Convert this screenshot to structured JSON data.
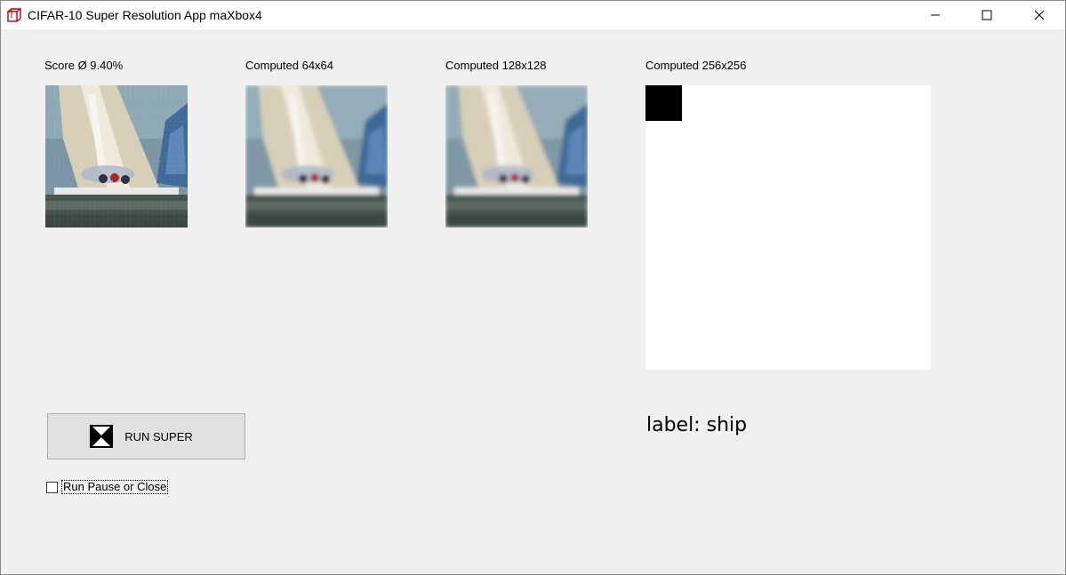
{
  "window": {
    "title": "CIFAR-10 Super Resolution App maXbox4"
  },
  "panels": [
    {
      "label": "Score Ø 9.40%"
    },
    {
      "label": "Computed 64x64"
    },
    {
      "label": "Computed 128x128"
    },
    {
      "label": "Computed 256x256"
    }
  ],
  "result": {
    "label": "label: ship"
  },
  "controls": {
    "run_button_label": "RUN SUPER",
    "run_button_icon": "x-hourglass-icon",
    "checkbox_label": "Run Pause or Close",
    "checkbox_checked": false
  },
  "colors": {
    "titlebar": "#ffffff",
    "background": "#f0f0f0",
    "button_face": "#e1e1e1"
  }
}
